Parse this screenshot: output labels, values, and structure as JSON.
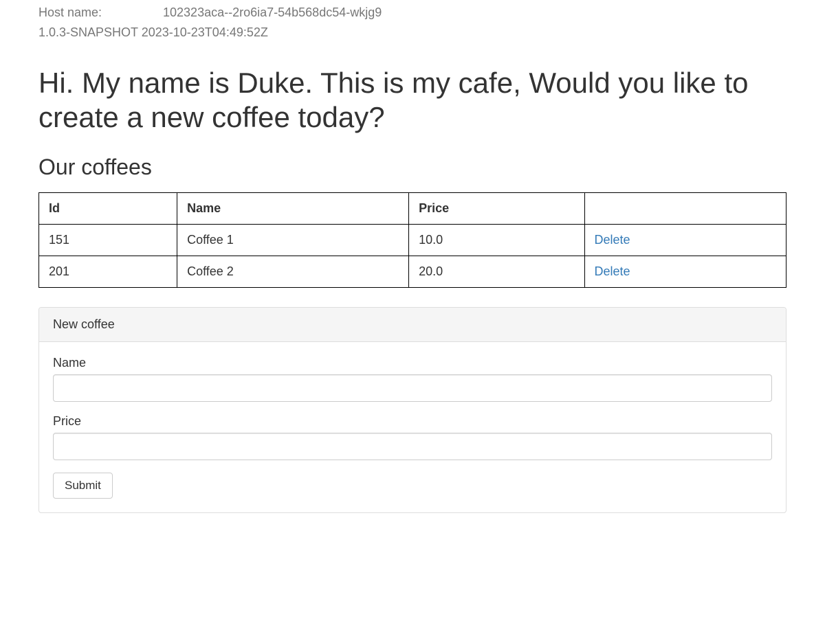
{
  "meta": {
    "host_label": "Host name:",
    "host_value": "102323aca--2ro6ia7-54b568dc54-wkjg9",
    "version_line": "1.0.3-SNAPSHOT 2023-10-23T04:49:52Z"
  },
  "page_title": "Hi. My name is Duke. This is my cafe, Would you like to create a new coffee today?",
  "coffees": {
    "section_title": "Our coffees",
    "headers": {
      "id": "Id",
      "name": "Name",
      "price": "Price",
      "actions": ""
    },
    "rows": [
      {
        "id": "151",
        "name": "Coffee 1",
        "price": "10.0",
        "delete_label": "Delete"
      },
      {
        "id": "201",
        "name": "Coffee 2",
        "price": "20.0",
        "delete_label": "Delete"
      }
    ]
  },
  "form": {
    "panel_title": "New coffee",
    "name_label": "Name",
    "name_value": "",
    "price_label": "Price",
    "price_value": "",
    "submit_label": "Submit"
  }
}
